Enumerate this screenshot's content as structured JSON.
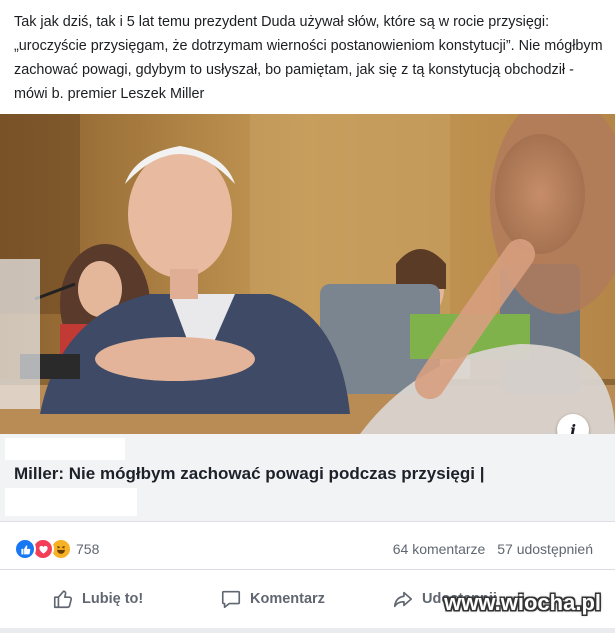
{
  "post": {
    "text": "Tak jak dziś, tak i 5 lat temu prezydent Duda używał słów, które są w rocie przysięgi: „uroczyście przysięgam, że dotrzymam wierności postanowieniom konstytucji”. Nie mógłbym zachować powagi, gdybym to usłyszał, bo pamiętam, jak się z tą konstytucją obchodził - mówi b. premier Leszek Miller"
  },
  "link": {
    "title": "Miller: Nie mógłbym zachować powagi podczas przysięgi |",
    "info_icon": "i"
  },
  "stats": {
    "reaction_icons": [
      "like-icon",
      "love-icon",
      "haha-icon"
    ],
    "reaction_count": "758",
    "comments": "64 komentarze",
    "shares": "57 udostępnień"
  },
  "actions": {
    "like": "Lubię to!",
    "comment": "Komentarz",
    "share": "Udostępnij"
  },
  "watermark": "www.wiocha.pl",
  "colors": {
    "like_blue": "#1877f2",
    "love_red": "#f33e58",
    "haha_yellow": "#f7b125",
    "muted_text": "#606770",
    "link_box_bg": "#f2f3f5"
  }
}
